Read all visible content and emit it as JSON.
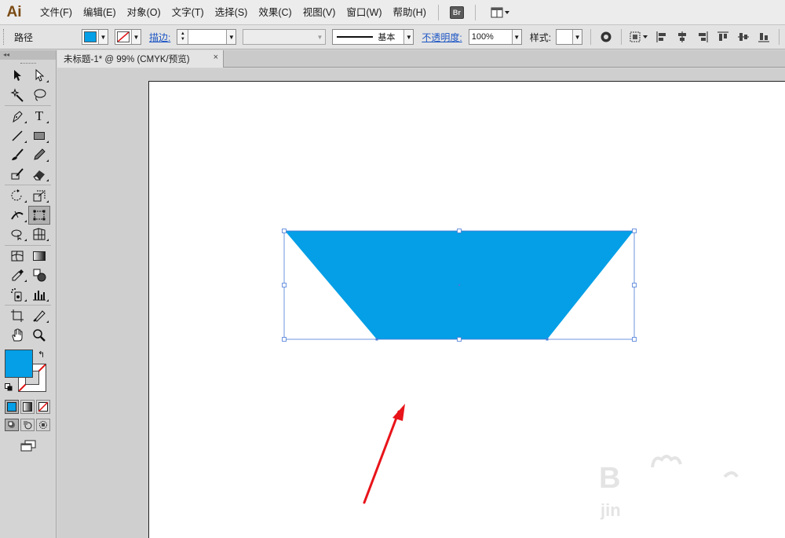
{
  "app": {
    "logo": "Ai"
  },
  "menu": {
    "items": [
      "文件(F)",
      "编辑(E)",
      "对象(O)",
      "文字(T)",
      "选择(S)",
      "效果(C)",
      "视图(V)",
      "窗口(W)",
      "帮助(H)"
    ],
    "bridge_label": "Br"
  },
  "control_bar": {
    "selection_type": "路径",
    "fill_color": "#049fe6",
    "stroke_label": "描边:",
    "stroke_weight": "",
    "brush_label": "基本",
    "opacity_label": "不透明度:",
    "opacity_value": "100%",
    "style_label": "样式:"
  },
  "document": {
    "tab_title": "未标题-1* @ 99% (CMYK/预览)",
    "close_glyph": "×"
  },
  "shape": {
    "fill": "#049fe6",
    "bbox_color": "#4a7bd8"
  },
  "annotation": {
    "arrow_color": "#e8141a"
  },
  "tools": {
    "fill_color": "#049fe6",
    "rows": [
      [
        "selection-tool",
        "direct-selection-tool"
      ],
      [
        "magic-wand-tool",
        "lasso-tool"
      ],
      [
        "pen-tool",
        "type-tool"
      ],
      [
        "line-segment-tool",
        "rectangle-tool"
      ],
      [
        "paintbrush-tool",
        "pencil-tool"
      ],
      [
        "blob-brush-tool",
        "eraser-tool"
      ],
      [
        "rotate-tool",
        "scale-tool"
      ],
      [
        "width-tool",
        "free-transform-tool"
      ],
      [
        "shape-builder-tool",
        "perspective-grid-tool"
      ],
      [
        "mesh-tool",
        "gradient-tool"
      ],
      [
        "eyedropper-tool",
        "blend-tool"
      ],
      [
        "symbol-sprayer-tool",
        "column-graph-tool"
      ],
      [
        "artboard-tool",
        "slice-tool"
      ],
      [
        "hand-tool",
        "zoom-tool"
      ]
    ]
  }
}
